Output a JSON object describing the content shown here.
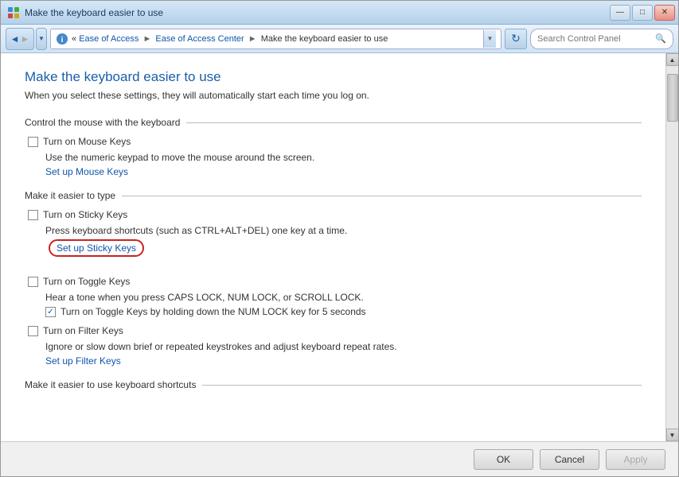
{
  "window": {
    "title": "Make the keyboard easier to use",
    "titlebar_icon": "control-panel-icon",
    "min_btn": "—",
    "max_btn": "□",
    "close_btn": "✕"
  },
  "navbar": {
    "back_btn": "◄",
    "forward_btn": "►",
    "recent_btn": "▼",
    "breadcrumb": {
      "part1": "«",
      "part2": "Ease of Access",
      "arrow1": "►",
      "part3": "Ease of Access Center",
      "arrow2": "►",
      "part4": "Make the keyboard easier to use"
    },
    "search_placeholder": "Search Control Panel",
    "refresh_icon": "↻"
  },
  "page": {
    "title": "Make the keyboard easier to use",
    "subtitle": "When you select these settings, they will automatically start each time you log on."
  },
  "sections": [
    {
      "id": "mouse-control",
      "label": "Control the mouse with the keyboard",
      "options": [
        {
          "id": "mouse-keys",
          "checkbox_label": "Turn on Mouse Keys",
          "checked": false,
          "description": "Use the numeric keypad to move the mouse around the screen.",
          "link": "Set up Mouse Keys",
          "link_circled": false
        }
      ]
    },
    {
      "id": "easier-typing",
      "label": "Make it easier to type",
      "options": [
        {
          "id": "sticky-keys",
          "checkbox_label": "Turn on Sticky Keys",
          "checked": false,
          "description": "Press keyboard shortcuts (such as CTRL+ALT+DEL) one key at a time.",
          "link": "Set up Sticky Keys",
          "link_circled": true
        },
        {
          "id": "toggle-keys",
          "checkbox_label": "Turn on Toggle Keys",
          "checked": false,
          "description": "Hear a tone when you press CAPS LOCK, NUM LOCK, or SCROLL LOCK.",
          "sub_option": {
            "checked": true,
            "label": "Turn on Toggle Keys by holding down the NUM LOCK key for 5 seconds"
          },
          "link": null
        },
        {
          "id": "filter-keys",
          "checkbox_label": "Turn on Filter Keys",
          "checked": false,
          "description": "Ignore or slow down brief or repeated keystrokes and adjust keyboard repeat rates.",
          "link": "Set up Filter Keys",
          "link_circled": false
        }
      ]
    },
    {
      "id": "keyboard-shortcuts",
      "label": "Make it easier to use keyboard shortcuts"
    }
  ],
  "footer": {
    "ok_label": "OK",
    "cancel_label": "Cancel",
    "apply_label": "Apply"
  }
}
